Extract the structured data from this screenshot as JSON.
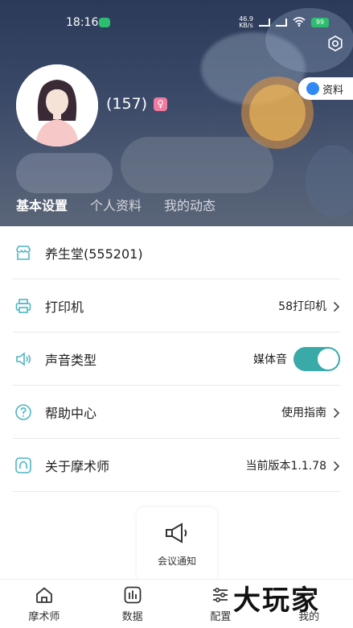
{
  "status_bar": {
    "time": "18:16",
    "net_speed": "46.9\nKB/s",
    "battery": "99"
  },
  "profile": {
    "name": "(157)",
    "gender_symbol": "♀",
    "profile_button_label": "资料"
  },
  "tabs": [
    {
      "label": "基本设置",
      "active": true
    },
    {
      "label": "个人资料",
      "active": false
    },
    {
      "label": "我的动态",
      "active": false
    }
  ],
  "settings": {
    "store": {
      "label": "养生堂(555201)"
    },
    "printer": {
      "label": "打印机",
      "value": "58打印机"
    },
    "sound": {
      "label": "声音类型",
      "value": "媒体音",
      "toggle_on": true
    },
    "help": {
      "label": "帮助中心",
      "value": "使用指南"
    },
    "about": {
      "label": "关于摩术师",
      "value": "当前版本1.1.78"
    }
  },
  "notice_card": {
    "label": "会议通知"
  },
  "bottom_nav": [
    {
      "label": "摩术师",
      "icon": "home-icon"
    },
    {
      "label": "数据",
      "icon": "chart-icon"
    },
    {
      "label": "配置",
      "icon": "sliders-icon"
    },
    {
      "label": "我的",
      "icon": "user-icon"
    }
  ],
  "watermark": {
    "text": "大玩家"
  },
  "colors": {
    "accent": "#3aaaa8",
    "icon_teal": "#4bb6c6",
    "header_dark": "#2c3a5a",
    "female_badge": "#f27aa0"
  }
}
